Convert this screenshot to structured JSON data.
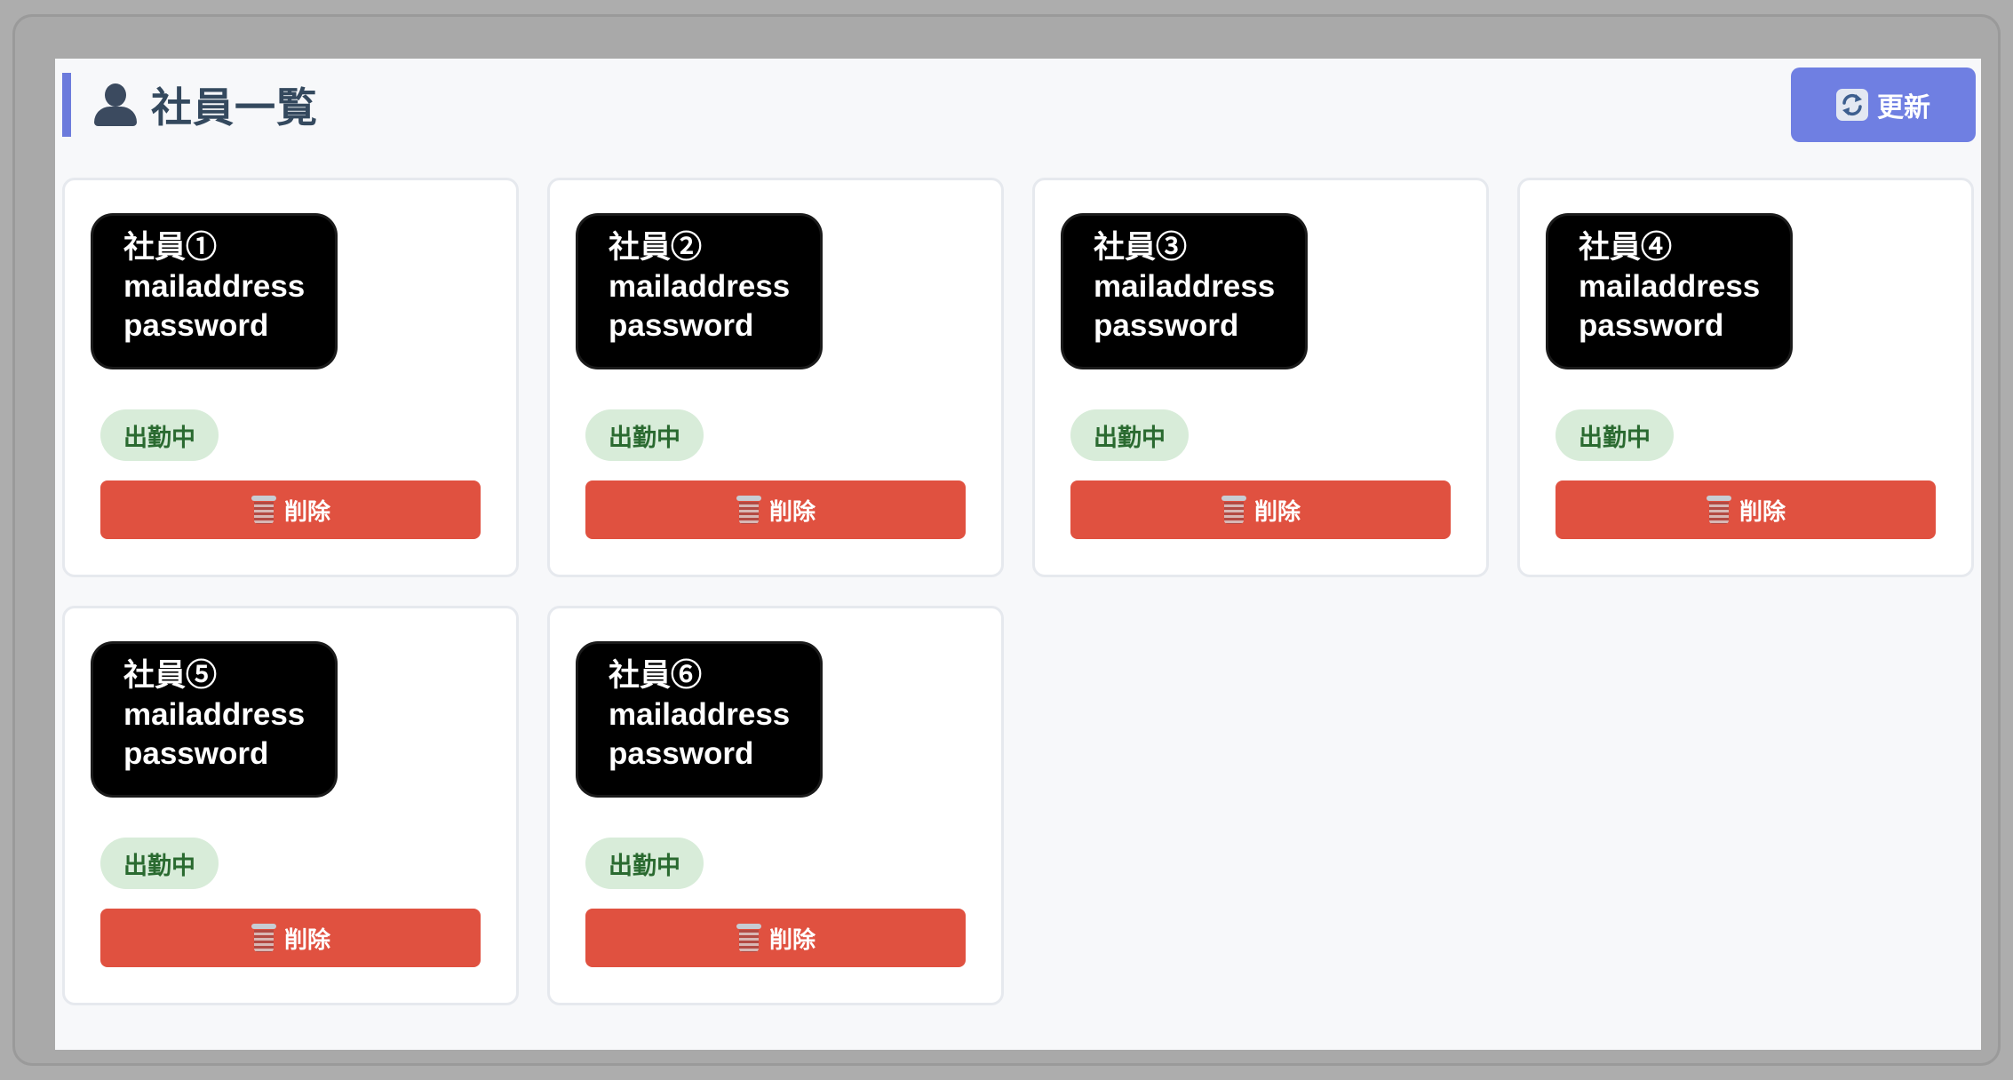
{
  "header": {
    "title": "社員一覧",
    "title_icon": "person-icon",
    "refresh_label": "更新",
    "refresh_icon": "refresh-icon"
  },
  "employees": [
    {
      "name": "社員①",
      "email": "mailaddress",
      "password": "password",
      "status": "出勤中",
      "delete_label": "削除"
    },
    {
      "name": "社員②",
      "email": "mailaddress",
      "password": "password",
      "status": "出勤中",
      "delete_label": "削除"
    },
    {
      "name": "社員③",
      "email": "mailaddress",
      "password": "password",
      "status": "出勤中",
      "delete_label": "削除"
    },
    {
      "name": "社員④",
      "email": "mailaddress",
      "password": "password",
      "status": "出勤中",
      "delete_label": "削除"
    },
    {
      "name": "社員⑤",
      "email": "mailaddress",
      "password": "password",
      "status": "出勤中",
      "delete_label": "削除"
    },
    {
      "name": "社員⑥",
      "email": "mailaddress",
      "password": "password",
      "status": "出勤中",
      "delete_label": "削除"
    }
  ],
  "colors": {
    "accent": "#6c7bdc",
    "refresh_button": "#6f7fe2",
    "delete_button": "#e05140",
    "status_badge_bg": "#d8ecd9",
    "status_badge_text": "#2a6a30"
  }
}
